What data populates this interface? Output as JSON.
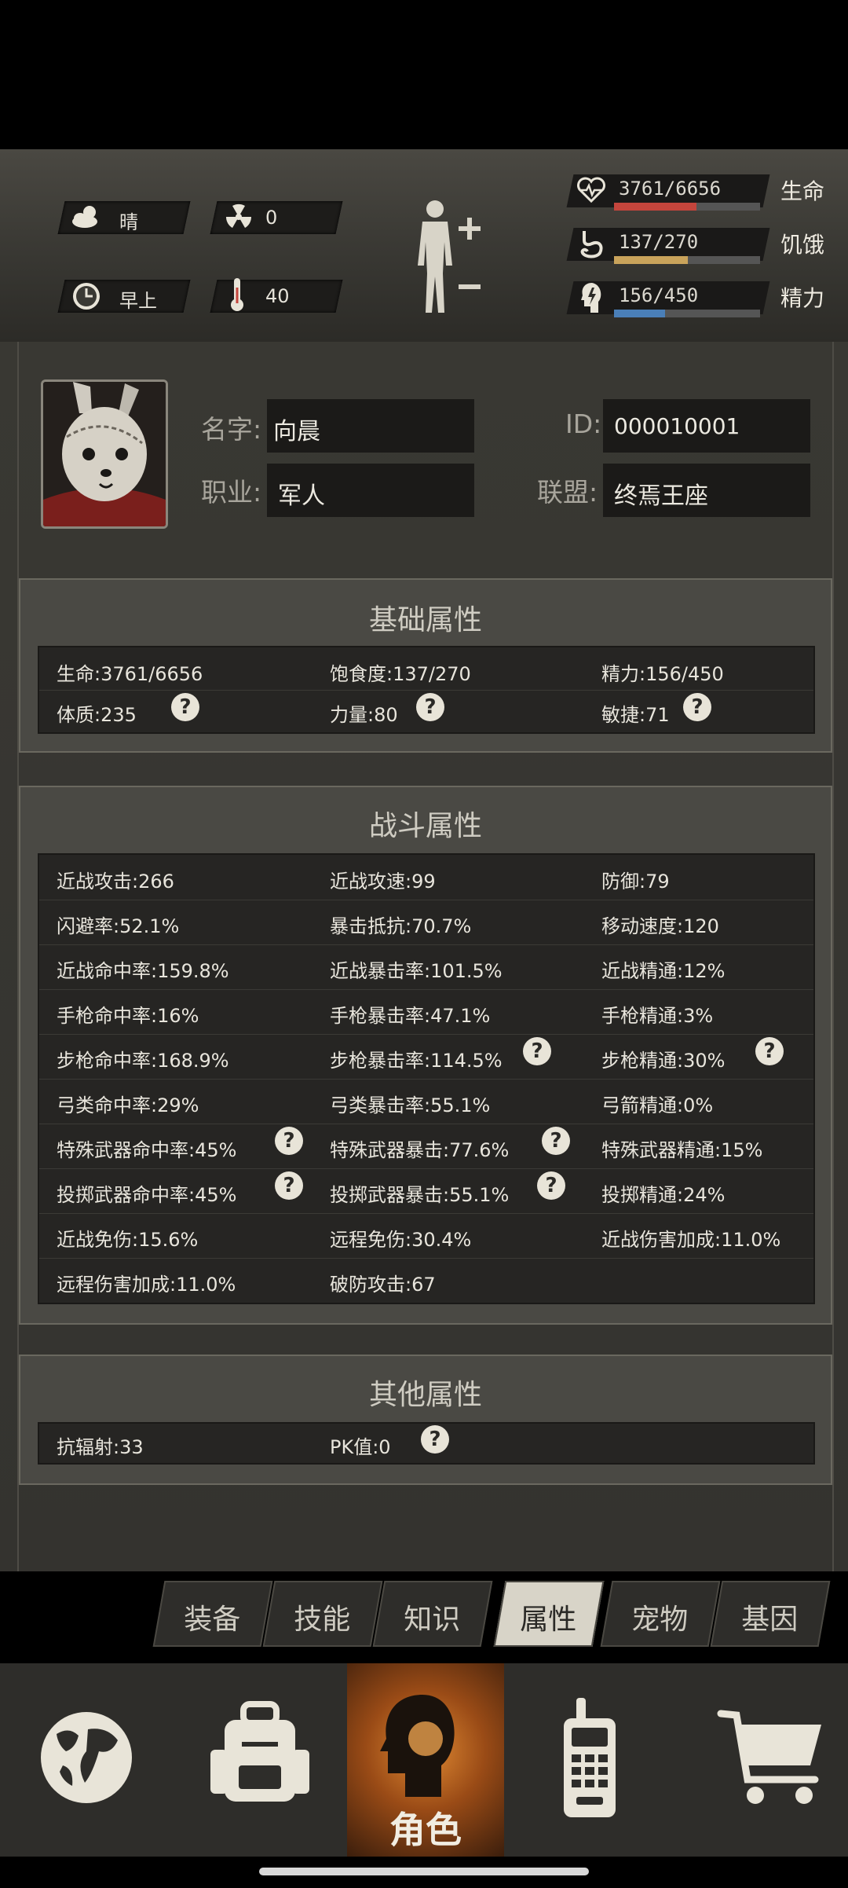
{
  "status": {
    "weather": "晴",
    "radiation": "0",
    "time_of_day": "早上",
    "temperature": "40",
    "health": {
      "text": "3761/6656",
      "label": "生命",
      "ratio": 0.565,
      "color": "#c4453c"
    },
    "hunger": {
      "text": "137/270",
      "label": "饥饿",
      "ratio": 0.507,
      "color": "#c9a35b"
    },
    "energy": {
      "text": "156/450",
      "label": "精力",
      "ratio": 0.347,
      "color": "#4a7fb8"
    }
  },
  "profile": {
    "name_label": "名字:",
    "name": "向晨",
    "id_label": "ID:",
    "id": "000010001",
    "job_label": "职业:",
    "job": "军人",
    "alliance_label": "联盟:",
    "alliance": "终焉王座"
  },
  "basic": {
    "title": "基础属性",
    "rows": [
      [
        "生命:3761/6656",
        "饱食度:137/270",
        "精力:156/450"
      ],
      [
        "体质:235",
        "力量:80",
        "敏捷:71"
      ]
    ]
  },
  "combat": {
    "title": "战斗属性",
    "rows": [
      [
        "近战攻击:266",
        "近战攻速:99",
        "防御:79"
      ],
      [
        "闪避率:52.1%",
        "暴击抵抗:70.7%",
        "移动速度:120"
      ],
      [
        "近战命中率:159.8%",
        "近战暴击率:101.5%",
        "近战精通:12%"
      ],
      [
        "手枪命中率:16%",
        "手枪暴击率:47.1%",
        "手枪精通:3%"
      ],
      [
        "步枪命中率:168.9%",
        "步枪暴击率:114.5%",
        "步枪精通:30%"
      ],
      [
        "弓类命中率:29%",
        "弓类暴击率:55.1%",
        "弓箭精通:0%"
      ],
      [
        "特殊武器命中率:45%",
        "特殊武器暴击:77.6%",
        "特殊武器精通:15%"
      ],
      [
        "投掷武器命中率:45%",
        "投掷武器暴击:55.1%",
        "投掷精通:24%"
      ],
      [
        "近战免伤:15.6%",
        "远程免伤:30.4%",
        "近战伤害加成:11.0%"
      ],
      [
        "远程伤害加成:11.0%",
        "破防攻击:67",
        ""
      ]
    ]
  },
  "other": {
    "title": "其他属性",
    "rows": [
      [
        "抗辐射:33",
        "PK值:0"
      ]
    ]
  },
  "help_glyph": "?",
  "tabs": [
    "装备",
    "技能",
    "知识",
    "属性",
    "宠物",
    "基因"
  ],
  "active_tab": "属性",
  "nav": {
    "role_label": "角色"
  }
}
